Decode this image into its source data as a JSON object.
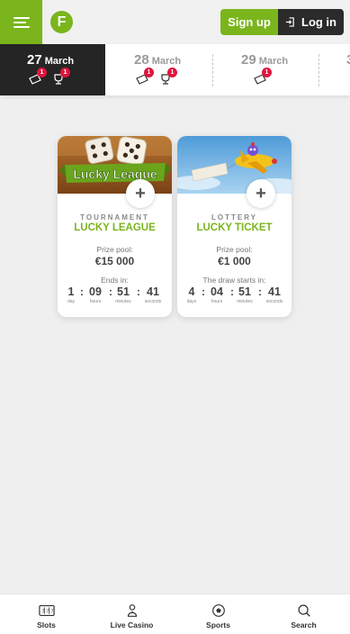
{
  "header": {
    "signup_label": "Sign up",
    "login_label": "Log in",
    "logo_letter": "F",
    "accent_color": "#7ab51d"
  },
  "dates": [
    {
      "day": "27",
      "month": "March",
      "active": true,
      "ticket_count": "1",
      "trophy_count": "1"
    },
    {
      "day": "28",
      "month": "March",
      "active": false,
      "ticket_count": "1",
      "trophy_count": ""
    },
    {
      "day": "29",
      "month": "March",
      "active": false,
      "ticket_count": "1",
      "trophy_count": ""
    },
    {
      "day": "3",
      "month": "",
      "active": false
    }
  ],
  "cards": [
    {
      "type": "TOURNAMENT",
      "title": "LUCKY LEAGUE",
      "banner_text": "Lucky League",
      "prize_label": "Prize pool:",
      "prize_value": "€15 000",
      "timer_label": "Ends in:",
      "timer": {
        "d": "1",
        "h": "09",
        "m": "51",
        "s": "41"
      },
      "units": {
        "d": "day",
        "h": "hours",
        "m": "minutes",
        "s": "seconds"
      }
    },
    {
      "type": "LOTTERY",
      "title": "LUCKY TICKET",
      "prize_label": "Prize pool:",
      "prize_value": "€1 000",
      "timer_label": "The draw starts in:",
      "timer": {
        "d": "4",
        "h": "04",
        "m": "51",
        "s": "41"
      },
      "units": {
        "d": "days",
        "h": "hours",
        "m": "minutes",
        "s": "seconds"
      }
    }
  ],
  "nav": {
    "slots": "Slots",
    "live_casino": "Live Casino",
    "sports": "Sports",
    "search": "Search"
  }
}
